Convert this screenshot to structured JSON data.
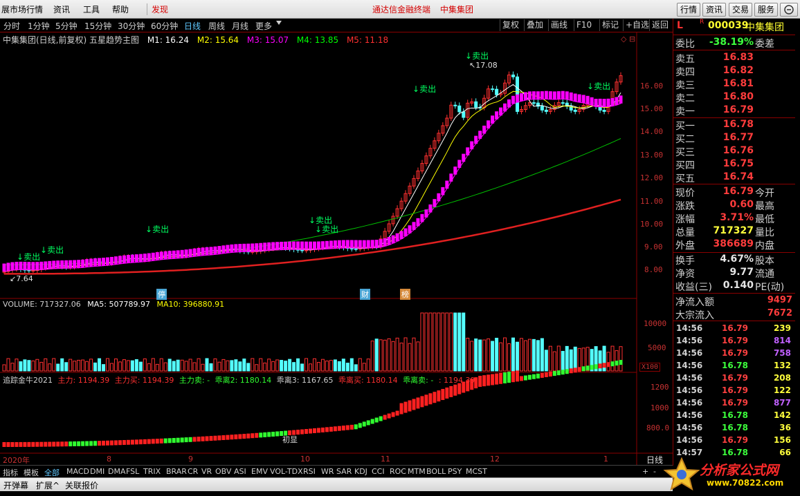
{
  "menubar": {
    "items": [
      "展市场行情",
      "资讯",
      "工具",
      "帮助",
      "发现"
    ],
    "center_title": "通达信金融终端",
    "center_stock": "中集集团",
    "right_buttons": [
      "行情",
      "资讯",
      "交易",
      "服务"
    ]
  },
  "periods": [
    "分时",
    "1分钟",
    "5分钟",
    "15分钟",
    "30分钟",
    "60分钟",
    "日线",
    "周线",
    "月线",
    "更多"
  ],
  "active_period": "日线",
  "tools": [
    "复权",
    "叠加",
    "画线",
    "F10",
    "标记",
    "+自选",
    "返回"
  ],
  "main": {
    "title": "中集集团(日线,前复权) 五星趋势主图",
    "ma": [
      {
        "label": "M1: 16.24",
        "color": "#ffffff"
      },
      {
        "label": "M2: 15.64",
        "color": "#ffff00"
      },
      {
        "label": "M3: 15.07",
        "color": "#ff00ff"
      },
      {
        "label": "M4: 13.85",
        "color": "#00ff00"
      },
      {
        "label": "M5: 11.18",
        "color": "#ff3030"
      }
    ],
    "price_axis": [
      "16.00",
      "15.00",
      "14.00",
      "13.00",
      "12.00",
      "11.00",
      "10.00",
      "9.00",
      "8.00"
    ],
    "high_label": "17.08",
    "low_label": "7.64",
    "signal_label": "卖出",
    "event_markers": [
      "停",
      "财",
      "榜"
    ]
  },
  "volume": {
    "title": "VOLUME: 717327.06",
    "ma5": "MA5: 507789.97",
    "ma10": "MA10: 396880.91",
    "axis": [
      "10000",
      "5000"
    ],
    "unit": "X100"
  },
  "indicator": {
    "name": "追踪金牛2021",
    "items": [
      {
        "label": "主力: 1194.39",
        "color": "#ff3030"
      },
      {
        "label": "主力买: 1194.39",
        "color": "#ff3030"
      },
      {
        "label": "主力卖: -",
        "color": "#30ff30"
      },
      {
        "label": "乖离2: 1180.14",
        "color": "#30ff30"
      },
      {
        "label": "乖离3: 1167.65",
        "color": "#d0d0d0"
      },
      {
        "label": "乖离买: 1180.14",
        "color": "#ff3030"
      },
      {
        "label": "乖离卖: -",
        "color": "#30ff30"
      },
      {
        "label": ": 1194.39",
        "color": "#ff3030"
      }
    ],
    "axis": [
      "1200",
      "1000",
      "800.0"
    ],
    "note": "初显"
  },
  "date_axis": [
    "2020年",
    "8",
    "9",
    "10",
    "11",
    "12",
    "1"
  ],
  "date_axis_right": "日线",
  "tabs": [
    "指标",
    "模板",
    "全部",
    "MACD",
    "DMI",
    "DMA",
    "FSL",
    "TRIX",
    "BRAR",
    "CR",
    "VR",
    "OBV",
    "ASI",
    "EMV",
    "VOL-TDX",
    "RSI",
    "WR",
    "SAR",
    "KDJ",
    "CCI",
    "ROC",
    "MTM",
    "BOLL",
    "PSY",
    "MCST"
  ],
  "tabs_controls": [
    "+",
    "-"
  ],
  "tabs2": [
    "开弹幕",
    "扩展^",
    "关联报价"
  ],
  "quote": {
    "code": "000039",
    "name": "中集集团",
    "header_l": "L",
    "header_r": "R",
    "weibi_label": "委比",
    "weibi_val": "-38.19%",
    "weicha_label": "委差",
    "asks": [
      {
        "label": "卖五",
        "price": "16.83"
      },
      {
        "label": "卖四",
        "price": "16.82"
      },
      {
        "label": "卖三",
        "price": "16.81"
      },
      {
        "label": "卖二",
        "price": "16.80"
      },
      {
        "label": "卖一",
        "price": "16.79"
      }
    ],
    "bids": [
      {
        "label": "买一",
        "price": "16.78"
      },
      {
        "label": "买二",
        "price": "16.77"
      },
      {
        "label": "买三",
        "price": "16.76"
      },
      {
        "label": "买四",
        "price": "16.75"
      },
      {
        "label": "买五",
        "price": "16.74"
      }
    ],
    "stats": [
      {
        "l": "现价",
        "v": "16.79",
        "r": "今开",
        "c": "red"
      },
      {
        "l": "涨跌",
        "v": "0.60",
        "r": "最高",
        "c": "red"
      },
      {
        "l": "涨幅",
        "v": "3.71%",
        "r": "最低",
        "c": "red"
      },
      {
        "l": "总量",
        "v": "717327",
        "r": "量比",
        "c": "yellow"
      },
      {
        "l": "外盘",
        "v": "386689",
        "r": "内盘",
        "c": "red"
      }
    ],
    "stats2": [
      {
        "l": "换手",
        "v": "4.67%",
        "r": "股本",
        "c": "white"
      },
      {
        "l": "净资",
        "v": "9.77",
        "r": "流通",
        "c": "white"
      },
      {
        "l": "收益(三)",
        "v": "0.140",
        "r": "PE(动)",
        "c": "white"
      }
    ],
    "flows": [
      {
        "l": "净流入额",
        "v": "9497"
      },
      {
        "l": "大宗流入",
        "v": "7672"
      }
    ],
    "ticks": [
      {
        "t": "14:56",
        "p": "16.79",
        "v": "239",
        "c": "yellow"
      },
      {
        "t": "14:56",
        "p": "16.79",
        "v": "814",
        "c": "purple"
      },
      {
        "t": "14:56",
        "p": "16.79",
        "v": "758",
        "c": "purple"
      },
      {
        "t": "14:56",
        "p": "16.78",
        "v": "132",
        "c": "yellow"
      },
      {
        "t": "14:56",
        "p": "16.79",
        "v": "208",
        "c": "yellow"
      },
      {
        "t": "14:56",
        "p": "16.79",
        "v": "122",
        "c": "yellow"
      },
      {
        "t": "14:56",
        "p": "16.79",
        "v": "877",
        "c": "purple"
      },
      {
        "t": "14:56",
        "p": "16.78",
        "v": "142",
        "c": "yellow"
      },
      {
        "t": "14:56",
        "p": "16.78",
        "v": "36",
        "c": "yellow"
      },
      {
        "t": "14:56",
        "p": "16.79",
        "v": "156",
        "c": "yellow"
      },
      {
        "t": "14:57",
        "p": "16.78",
        "v": "66",
        "c": "yellow"
      }
    ]
  },
  "watermark": {
    "site": "分析家公式网",
    "url": "www.70822.com"
  }
}
